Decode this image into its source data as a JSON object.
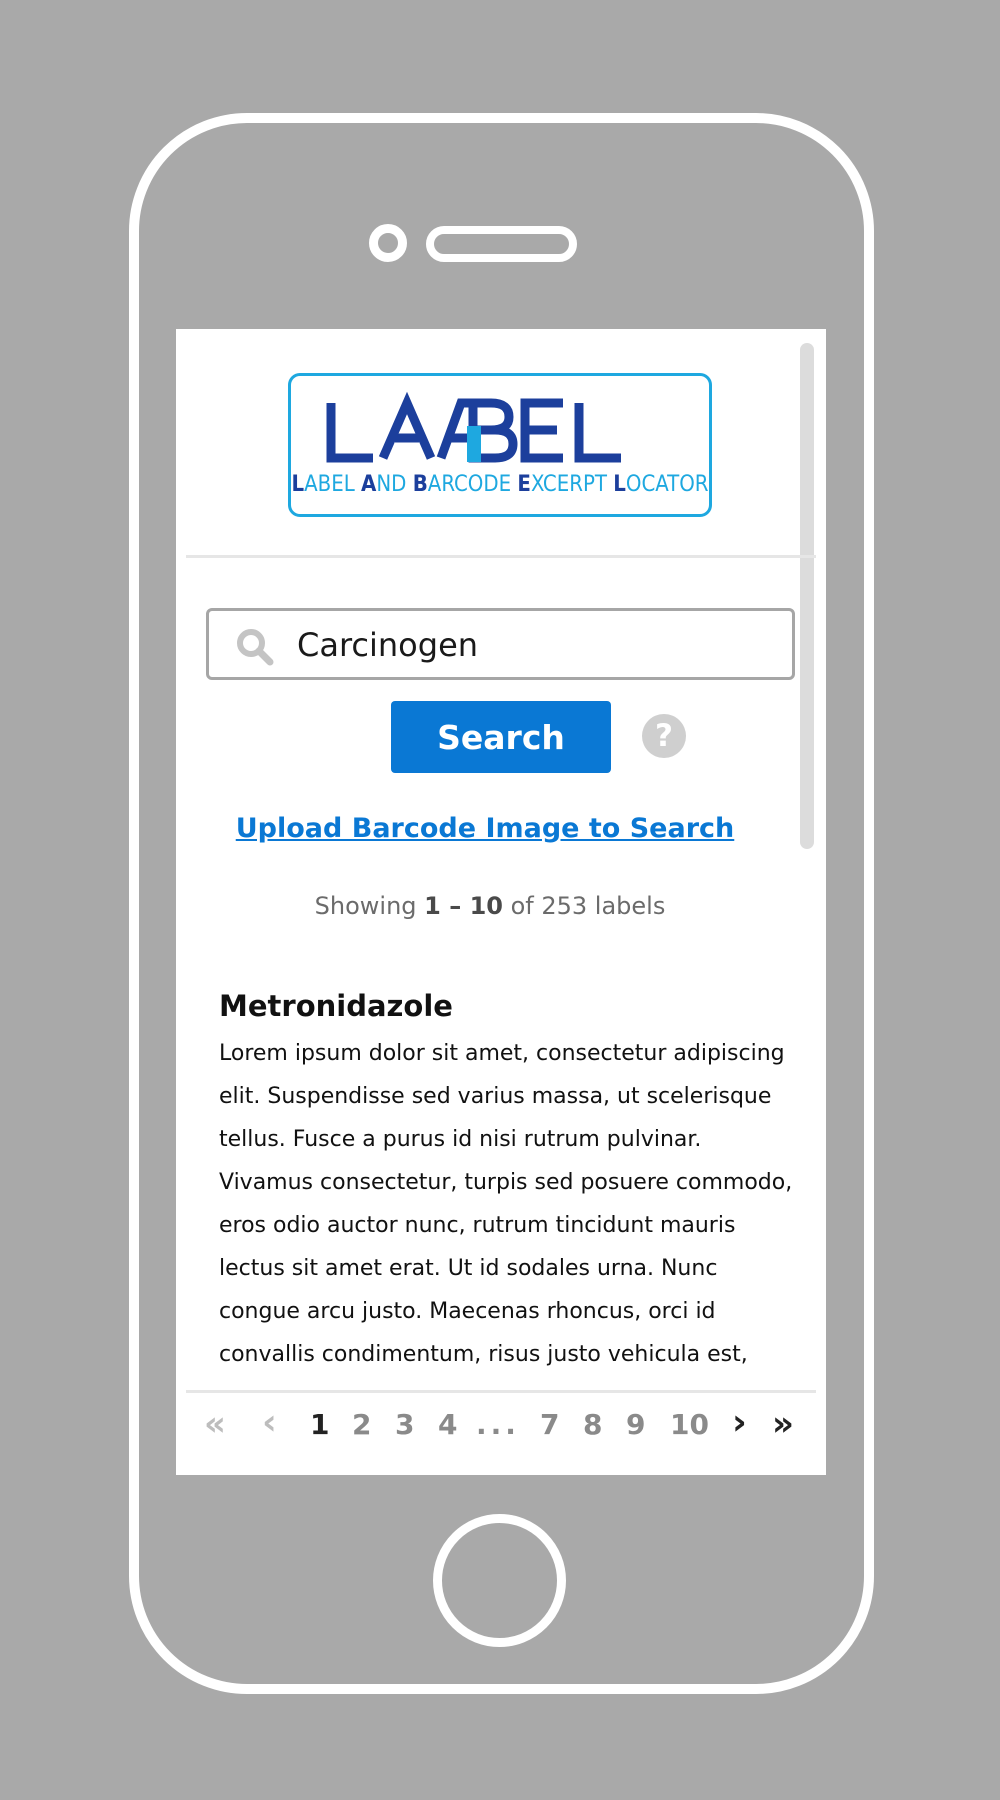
{
  "logo": {
    "wordmark": "LABEL",
    "tagline_parts": [
      {
        "text": "L",
        "bold": true
      },
      {
        "text": "ABEL ",
        "bold": false
      },
      {
        "text": "A",
        "bold": true
      },
      {
        "text": "ND ",
        "bold": false
      },
      {
        "text": "B",
        "bold": true
      },
      {
        "text": "ARCODE ",
        "bold": false
      },
      {
        "text": "E",
        "bold": true
      },
      {
        "text": "XCERPT ",
        "bold": false
      },
      {
        "text": "L",
        "bold": true
      },
      {
        "text": "OCATOR",
        "bold": false
      }
    ],
    "colors": {
      "dark": "#1c3f9c",
      "light": "#1ea8e0"
    }
  },
  "search": {
    "value": "Carcinogen",
    "button_label": "Search",
    "help_label": "?"
  },
  "upload_link": "Upload Barcode Image to Search",
  "results_summary": {
    "prefix": "Showing ",
    "range": "1 – 10",
    "suffix": " of 253 labels"
  },
  "result": {
    "title": "Metronidazole",
    "body": "Lorem ipsum dolor sit amet, consectetur adipiscing elit. Suspendisse sed varius massa, ut scelerisque tellus. Fusce a purus id nisi rutrum pulvinar. Vivamus consectetur, turpis sed posuere commodo, eros odio auctor nunc, rutrum tincidunt mauris lectus sit amet erat. Ut id sodales urna. Nunc congue arcu justo. Maecenas rhoncus, orci id convallis condimentum, risus justo vehicula est, eget condimentum nisl urna"
  },
  "pagination": {
    "first": "«",
    "prev": "‹",
    "pages": [
      "1",
      "2",
      "3",
      "4",
      "...",
      "7",
      "8",
      "9",
      "10"
    ],
    "current": "1",
    "next": "›",
    "last": "»"
  },
  "colors": {
    "accent": "#0a78d4",
    "background": "#a9a9a9"
  }
}
